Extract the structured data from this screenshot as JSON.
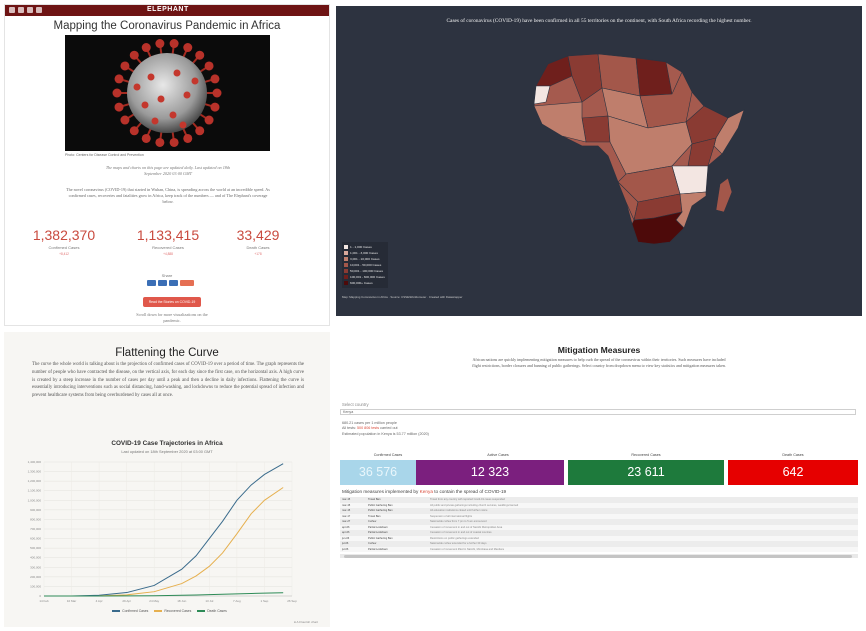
{
  "panel1": {
    "brand": "ELEPHANT",
    "title": "Mapping the Coronavirus Pandemic in Africa",
    "photo_caption": "Photo: Centers for Disease Control and Prevention",
    "updated_note": "The maps and charts on this page are updated daily. Last updated on 18th September 2020 03:00 GMT",
    "intro": "The novel coronavirus (COVID-19) that started in Wuhan, China, is spreading across the world at an incredible speed. As confirmed cases, recoveries and fatalities grow in Africa, keep track of the numbers — and of The Elephant's coverage below.",
    "stats": [
      {
        "value": "1,382,370",
        "label": "Confirmed Cases",
        "change": "+8,412"
      },
      {
        "value": "1,133,415",
        "label": "Recovered Cases",
        "change": "+4,888"
      },
      {
        "value": "33,429",
        "label": "Death Cases",
        "change": "+178"
      }
    ],
    "share_label": "Share",
    "cta_label": "Read the Stories on COVID-19",
    "scroll_note": "Scroll down for more visualizations on the pandemic.",
    "colors": {
      "topbar": "#6e1414",
      "stat": "#c94a3e",
      "cta": "#e0584b"
    }
  },
  "panel2": {
    "title": "Cases of coronavirus (COVID-19) have been confirmed in all 55 territories on the continent, with South Africa recording the highest number.",
    "legend": [
      {
        "label": "1 - 1,000 Cases",
        "color": "#f3e6e2"
      },
      {
        "label": "1,001 - 3,000 Cases",
        "color": "#d9a99c"
      },
      {
        "label": "3,001 - 10,000 Cases",
        "color": "#bf7e6c"
      },
      {
        "label": "10,001 - 50,000 Cases",
        "color": "#a3574a"
      },
      {
        "label": "50,001 - 100,000 Cases",
        "color": "#8a3b33"
      },
      {
        "label": "100,001 - 600,000 Cases",
        "color": "#6f1f1c"
      },
      {
        "label": "600,000+ Cases",
        "color": "#4d0a0a"
      }
    ],
    "footer": "Map: Mapping Coronavirus in Africa · Source: CSSE/Worldometer · Created with Datawrapper",
    "colors": {
      "background": "#2d3340"
    }
  },
  "panel3": {
    "title": "Flattening the Curve",
    "body": "The curve the whole world is talking about is the projection of confirmed cases of COVID-19 over a period of time. The graph represents the number of people who have contracted the disease, on the vertical axis, for each day since the first case, on the horizontal axis. A high curve is created by a steep increase in the number of cases per day until a peak and then a decline in daily infections. Flattening the curve is essentially introducing interventions such as social distancing, hand-washing, and lockdowns to reduce the potential spread of infection and prevent healthcare systems from being overburdened by cases all at once.",
    "chart_data": {
      "type": "line",
      "title": "COVID-19 Case Trajectories in Africa",
      "subtitle": "Last updated on 18th September 2020 at 03:00 GMT",
      "ylabel": "",
      "ylim": [
        0,
        1400000
      ],
      "y_ticks": [
        "0",
        "100,000",
        "200,000",
        "300,000",
        "400,000",
        "500,000",
        "600,000",
        "700,000",
        "800,000",
        "900,000",
        "1,000,000",
        "1,100,000",
        "1,200,000",
        "1,300,000",
        "1,400,000"
      ],
      "x_ticks": [
        "14 Feb",
        "10 Mar",
        "4 Apr",
        "29 Apr",
        "24 May",
        "18 Jun",
        "13 Jul",
        "7 Aug",
        "1 Sep",
        "26 Sep"
      ],
      "x_range": [
        "2020-02-14",
        "2020-09-26"
      ],
      "grid": true,
      "legend_position": "bottom",
      "series": [
        {
          "name": "Confirmed Cases",
          "color": "#3a6b8c",
          "x": [
            "2020-02-14",
            "2020-03-10",
            "2020-04-04",
            "2020-04-29",
            "2020-05-24",
            "2020-06-18",
            "2020-07-01",
            "2020-07-13",
            "2020-07-25",
            "2020-08-07",
            "2020-08-20",
            "2020-09-01",
            "2020-09-18"
          ],
          "values": [
            0,
            200,
            8000,
            36000,
            110000,
            280000,
            420000,
            600000,
            780000,
            1000000,
            1160000,
            1270000,
            1382370
          ]
        },
        {
          "name": "Recovered Cases",
          "color": "#e6b04f",
          "x": [
            "2020-02-14",
            "2020-03-10",
            "2020-04-04",
            "2020-04-29",
            "2020-05-24",
            "2020-06-18",
            "2020-07-01",
            "2020-07-13",
            "2020-07-25",
            "2020-08-07",
            "2020-08-20",
            "2020-09-01",
            "2020-09-18"
          ],
          "values": [
            0,
            0,
            1000,
            12000,
            45000,
            130000,
            210000,
            310000,
            450000,
            650000,
            860000,
            1000000,
            1133415
          ]
        },
        {
          "name": "Death Cases",
          "color": "#2e8b57",
          "x": [
            "2020-02-14",
            "2020-03-10",
            "2020-04-04",
            "2020-04-29",
            "2020-05-24",
            "2020-06-18",
            "2020-07-01",
            "2020-07-13",
            "2020-07-25",
            "2020-08-07",
            "2020-08-20",
            "2020-09-01",
            "2020-09-18"
          ],
          "values": [
            0,
            0,
            400,
            1400,
            3200,
            7300,
            10500,
            14000,
            18000,
            22500,
            26500,
            30500,
            33429
          ]
        }
      ]
    },
    "credit": "● A Flourish chart"
  },
  "panel4": {
    "title": "Mitigation Measures",
    "intro": "African nations are quickly implementing mitigation measures to help curb the spread of the coronavirus within their territories. Such measures have included flight restrictions, border closures and banning of public gatherings. Select country from dropdown menu to view key statistics and mitigation measures taken.",
    "select_label": "Select country",
    "selected_country": "Kenya",
    "info": {
      "line1": "680.21 cases per 1 million people",
      "line2_prefix": "All tests: ",
      "line2_value": "500 806 tests",
      "line2_suffix": " carried out",
      "line3": "Estimated population in Kenya is 53.77 million (2020)"
    },
    "boxes": [
      {
        "label": "Confirmed Cases",
        "value": "36 576",
        "color": "#a9d6ea",
        "text_color": "#e9f6fb"
      },
      {
        "label": "Active Cases",
        "value": "12 323",
        "color": "#7b1f7e",
        "text_color": "#ffffff"
      },
      {
        "label": "Recovered Cases",
        "value": "23 611",
        "color": "#1e7a3c",
        "text_color": "#ffffff"
      },
      {
        "label": "Death Cases",
        "value": "642",
        "color": "#e60000",
        "text_color": "#ffffff"
      }
    ],
    "mitigation_prefix": "Mitigation measures implemented by ",
    "mitigation_country": "Kenya",
    "mitigation_suffix": " to contain the spread of COVID-19",
    "measures": [
      {
        "date": "mar-15",
        "type": "Travel Ban",
        "detail": "Travel from any country with reported Covid-19 cases suspended"
      },
      {
        "date": "mar-15",
        "type": "Public Gathering Ban",
        "detail": "All public and private gatherings including church services, weddings banned"
      },
      {
        "date": "mar-15",
        "type": "Public Gathering Ban",
        "detail": "All education institutions closed until further notice"
      },
      {
        "date": "mar-17",
        "type": "Travel Ban",
        "detail": "Suspension of all international flights"
      },
      {
        "date": "mar-27",
        "type": "Curfew",
        "detail": "Nationwide curfew from 7 pm to 5 am announced"
      },
      {
        "date": "apr-06",
        "type": "Partial Lockdown",
        "detail": "Cessation of movement in and out of Nairobi Metropolitan Area"
      },
      {
        "date": "apr-06",
        "type": "Partial Lockdown",
        "detail": "Cessation of movement in and out of coastal counties"
      },
      {
        "date": "jun-06",
        "type": "Public Gathering Ban",
        "detail": "Restrictions on public gatherings extended"
      },
      {
        "date": "jul-06",
        "type": "Curfew",
        "detail": "Nationwide curfew extended for a further 30 days"
      },
      {
        "date": "jul-06",
        "type": "Partial Lockdown",
        "detail": "Cessation of movement lifted in Nairobi, Mombasa and Mandera"
      }
    ]
  }
}
